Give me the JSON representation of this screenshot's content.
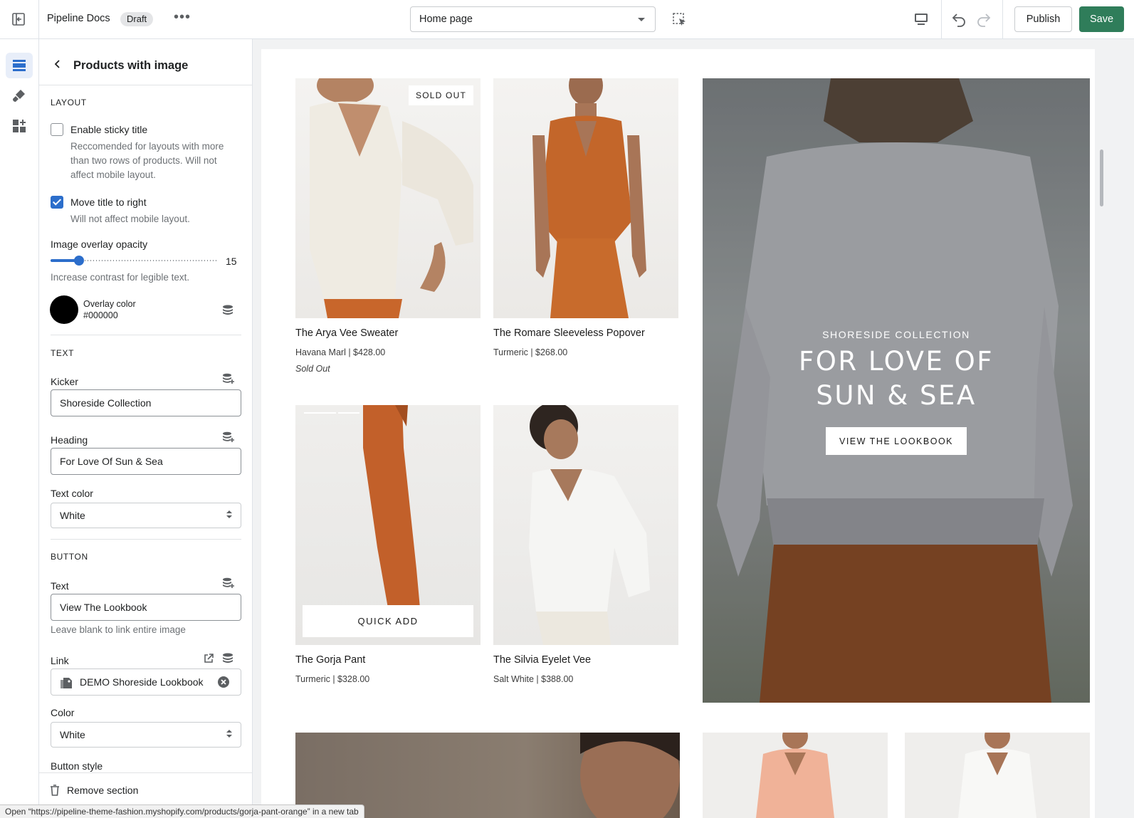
{
  "topbar": {
    "store_name": "Pipeline Docs",
    "draft_badge": "Draft",
    "more_label": "•••",
    "page_select": "Home page",
    "publish_label": "Publish",
    "save_label": "Save",
    "accent": "#2f7d5a"
  },
  "rail": {
    "items": [
      "sections-icon",
      "theme-settings-icon",
      "app-blocks-icon"
    ],
    "active": 0
  },
  "panel": {
    "title": "Products with image",
    "layout": {
      "label": "LAYOUT",
      "sticky_title": {
        "label": "Enable sticky title",
        "checked": false,
        "help": "Reccomended for layouts with more than two rows of products. Will not affect mobile layout."
      },
      "title_right": {
        "label": "Move title to right",
        "checked": true,
        "help": "Will not affect mobile layout."
      },
      "opacity": {
        "label": "Image overlay opacity",
        "value": "15",
        "help": "Increase contrast for legible text.",
        "fraction": 0.15
      },
      "overlay_color": {
        "label": "Overlay color",
        "value": "#000000"
      }
    },
    "text": {
      "label": "TEXT",
      "kicker": {
        "label": "Kicker",
        "value": "Shoreside Collection"
      },
      "heading": {
        "label": "Heading",
        "value": "For Love Of Sun & Sea"
      },
      "text_color": {
        "label": "Text color",
        "value": "White"
      }
    },
    "button": {
      "label": "BUTTON",
      "text": {
        "label": "Text",
        "value": "View The Lookbook",
        "help": "Leave blank to link entire image"
      },
      "link": {
        "label": "Link",
        "value": "DEMO Shoreside Lookbook"
      },
      "color": {
        "label": "Color",
        "value": "White"
      },
      "style_label": "Button style"
    },
    "remove_section": "Remove section"
  },
  "preview": {
    "products": [
      {
        "name": "The Arya Vee Sweater",
        "meta": "Havana Marl | $428.00",
        "status": "Sold Out",
        "badge": "SOLD OUT"
      },
      {
        "name": "The Romare Sleeveless Popover",
        "meta": "Turmeric | $268.00"
      },
      {
        "name": "The Gorja Pant",
        "meta": "Turmeric | $328.00",
        "quick_add": "QUICK ADD"
      },
      {
        "name": "The Silvia Eyelet Vee",
        "meta": "Salt White | $388.00"
      }
    ],
    "feature": {
      "kicker": "SHORESIDE COLLECTION",
      "heading_line1": "FOR LOVE OF",
      "heading_line2": "SUN & SEA",
      "button": "VIEW THE LOOKBOOK"
    }
  },
  "statusbar": {
    "text": "Open “https://pipeline-theme-fashion.myshopify.com/products/gorja-pant-orange” in a new tab"
  }
}
